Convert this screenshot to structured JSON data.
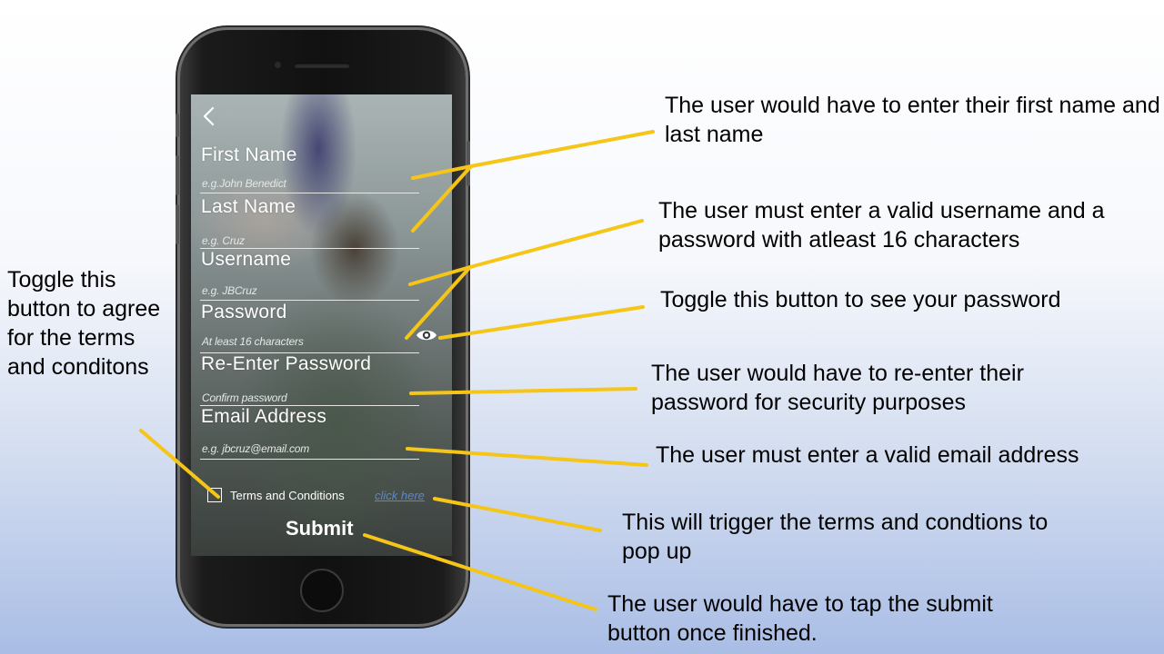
{
  "form": {
    "fields": [
      {
        "label": "First Name",
        "placeholder": "e.g.John Benedict"
      },
      {
        "label": "Last Name",
        "placeholder": "e.g. Cruz"
      },
      {
        "label": "Username",
        "placeholder": "e.g. JBCruz"
      },
      {
        "label": "Password",
        "placeholder": "At least 16 characters"
      },
      {
        "label": "Re-Enter Password",
        "placeholder": "Confirm password"
      },
      {
        "label": "Email Address",
        "placeholder": "e.g. jbcruz@email.com"
      }
    ],
    "terms_label": "Terms and Conditions",
    "terms_link": "click here",
    "submit_label": "Submit",
    "icons": [
      "back-arrow-icon",
      "eye-icon",
      "checkbox"
    ]
  },
  "annotations": {
    "name": "The user would have to enter their first name and last name",
    "credentials": "The user must enter a valid username and a password with atleast 16 characters",
    "toggle_password": "Toggle this button to see your password",
    "reenter": "The user would have to re-enter their password for security purposes",
    "email": "The user must enter a valid email address",
    "terms_popup": "This will trigger the terms and condtions to pop up",
    "submit": "The user would have to tap the submit button once finished.",
    "checkbox": "Toggle this button to agree for the terms and conditons"
  },
  "colors": {
    "leader_line": "#f5c518",
    "link": "#5e86c8",
    "background_top": "#ffffff",
    "background_bottom": "#a9bde5"
  }
}
